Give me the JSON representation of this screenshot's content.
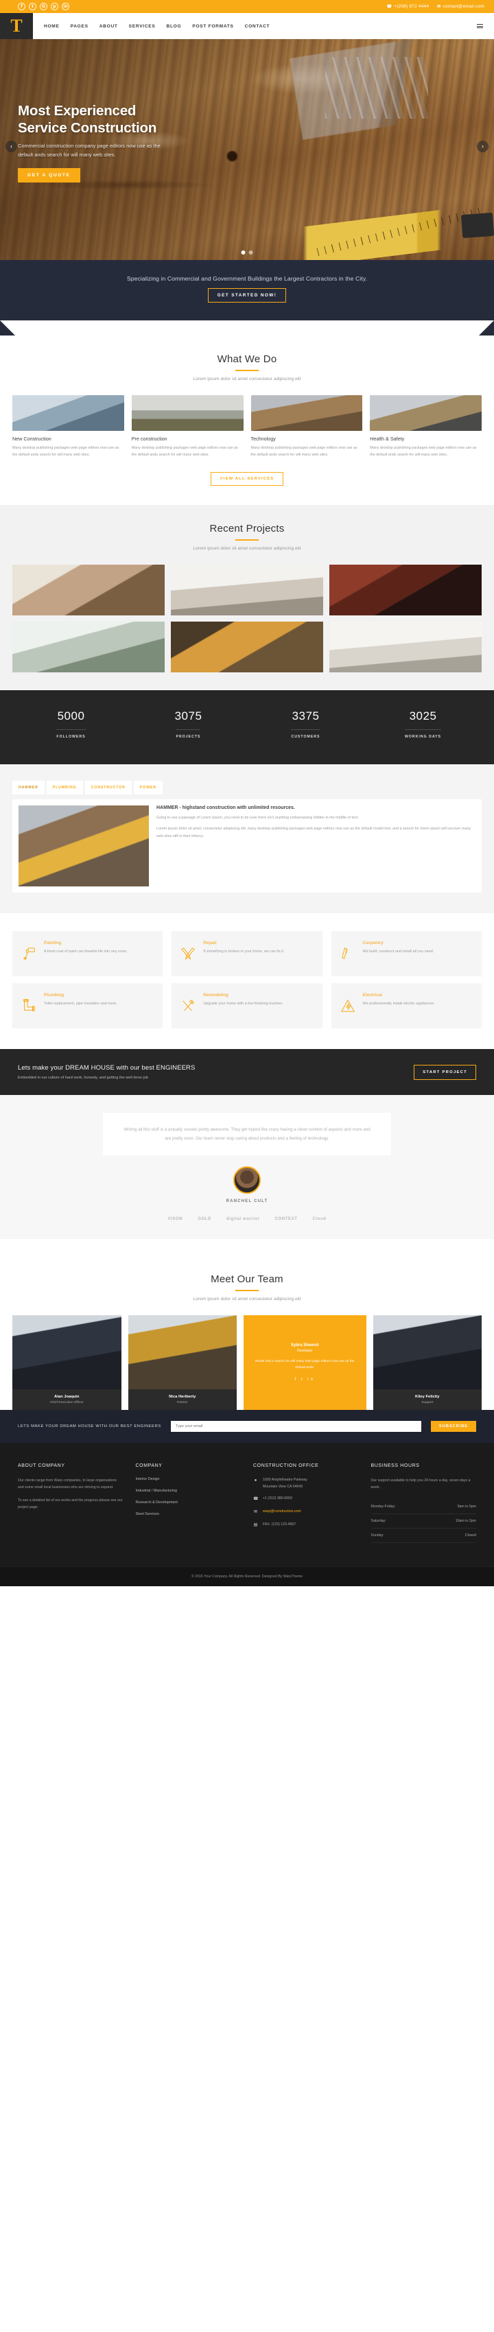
{
  "topbar": {
    "social": [
      {
        "name": "facebook-icon",
        "glyph": "f"
      },
      {
        "name": "twitter-icon",
        "glyph": "t"
      },
      {
        "name": "google-plus-icon",
        "glyph": "G"
      },
      {
        "name": "pinterest-icon",
        "glyph": "p"
      },
      {
        "name": "linkedin-icon",
        "glyph": "in"
      }
    ],
    "phone": "+(208) 872 4444",
    "email": "contact@email.com"
  },
  "nav": {
    "logo": "T",
    "items": [
      {
        "label": "HOME"
      },
      {
        "label": "PAGES"
      },
      {
        "label": "ABOUT"
      },
      {
        "label": "SERVICES"
      },
      {
        "label": "BLOG"
      },
      {
        "label": "POST FORMATS"
      },
      {
        "label": "CONTACT"
      }
    ]
  },
  "hero": {
    "title_line1": "Most Experienced",
    "title_line2": "Service Construction",
    "subtitle": "Commercial construction company page editors now use as the default ands search for will many web sites.",
    "cta": "GET A QUOTE",
    "prev": "‹",
    "next": "›"
  },
  "band": {
    "text": "Specializing in Commercial and Government Buildings the Largest Contractors in the City.",
    "cta": "GET STARTED NOW!"
  },
  "what_we_do": {
    "title": "What We Do",
    "subtitle": "Lorem ipsum dolor sit amet consectetur adipiscing elit",
    "cards": [
      {
        "title": "New Construction",
        "text": "Many desktop publishing packages web page editors now use as the default ands search for will many web sites."
      },
      {
        "title": "Pre construction",
        "text": "Many desktop publishing packages web page editors now use as the default ands search for will many web sites."
      },
      {
        "title": "Technology",
        "text": "Many desktop publishing packages web page editors now use as the default ands search for will many web sites."
      },
      {
        "title": "Health & Safety",
        "text": "Many desktop publishing packages web page editors now use as the default ands search for will many web sites."
      }
    ],
    "see_all": "VIEW ALL SERVICES"
  },
  "projects": {
    "title": "Recent Projects",
    "subtitle": "Lorem ipsum dolor sit amet consectetur adipiscing elit"
  },
  "counters": [
    {
      "number": "5000",
      "label": "FOLLOWERS"
    },
    {
      "number": "3075",
      "label": "PROJECTS"
    },
    {
      "number": "3375",
      "label": "CUSTOMERS"
    },
    {
      "number": "3025",
      "label": "WORKING DAYS"
    }
  ],
  "tabs": {
    "items": [
      {
        "label": "HAMMER"
      },
      {
        "label": "PLUMBING"
      },
      {
        "label": "CONSTRUCTOR"
      },
      {
        "label": "POWER"
      }
    ],
    "active": "HAMMER",
    "heading": "HAMMER - highstand construction with unlimited resources.",
    "para1": "Going to use a passage of Lorem Ipsum, you need to be sure there isn't anything embarrassing hidden in the middle of text.",
    "para2": "Lorem ipsum dolor sit amet, consectetur adipiscing elit, many desktop publishing packages web page editors now use as the default model text, and a search for lorem ipsum will uncover many web sites still in their infancy."
  },
  "features": [
    {
      "title": "Painting",
      "text": "A fresh coat of paint can breathe life into any room.",
      "icon": "paint-roller-icon"
    },
    {
      "title": "Repair",
      "text": "If something is broken in your home, we can fix it.",
      "icon": "pliers-icon"
    },
    {
      "title": "Carpentry",
      "text": "We build, construct and install all you need.",
      "icon": "saw-icon"
    },
    {
      "title": "Plumbing",
      "text": "Toilet replacement, pipe insulation and more.",
      "icon": "pipe-icon"
    },
    {
      "title": "Remodeling",
      "text": "Upgrade your home with a few finishing touches.",
      "icon": "ruler-pencil-icon"
    },
    {
      "title": "Electrical",
      "text": "We professionally install electric appliances.",
      "icon": "electric-hazard-icon"
    }
  ],
  "dream": {
    "title": "Lets make your DREAM HOUSE with our best ENGINEERS",
    "subtitle": "Embedded in our culture of hard work, honesty, and getting the well done job",
    "cta": "START PROJECT"
  },
  "testimonial": {
    "quote": "Writing all this stuff is a actually sounds pretty awesome. They get hyped like crazy having a clean context of aspects and more and are pretty soon. Our team never stop caring about products and a feeling of technology.",
    "name": "RANCHEL CULT"
  },
  "client_logos": [
    "VISON",
    "GOLD",
    "digital warrior",
    "CONTEXT",
    "Cloud"
  ],
  "team": {
    "title": "Meet Our Team",
    "subtitle": "Lorem ipsum dolor sit amet consectetur adipiscing elit",
    "members": [
      {
        "name": "Alan Joaquin",
        "role": "Chief Executive Officer",
        "highlight": false
      },
      {
        "name": "Nica Heriberty",
        "role": "Partner",
        "highlight": false
      },
      {
        "name": "Sybra Sheerot",
        "role": "Developer",
        "highlight": true,
        "bio": "Model and a search for will many web page editors now use as the default ands.",
        "social": "f  t  in"
      },
      {
        "name": "Kiley Felicity",
        "role": "Support",
        "highlight": false
      }
    ]
  },
  "subscribe": {
    "text": "LETS MAKE YOUR DREAM HOUSE WITH OUR BEST ENGINEERS",
    "placeholder": "Type your email",
    "button": "SUBSCRIBE"
  },
  "footer": {
    "about": {
      "title": "ABOUT COMPANY",
      "p1": "Our clients range from Warp companies, to large organisations and some small local businesses who are striving to expand.",
      "p2": "To see a detailed list of our works and the progress please see our project page."
    },
    "company": {
      "title": "COMPANY",
      "links": [
        "Interior Design",
        "Industrial / Manufacturing",
        "Research & Development",
        "Steel Services"
      ]
    },
    "office": {
      "title": "CONSTRUCTION OFFICE",
      "address_line1": "1600 Amphitheatre Parkway",
      "address_line2": "Mountain View CA 94043",
      "phone": "+1 (312) 380-6650",
      "email": "warp@construction.com",
      "fax": "FAX. (123) 123-4567"
    },
    "hours": {
      "title": "BUSINESS HOURS",
      "note": "Our support available to help you 24 hours a day, seven days a week.",
      "rows": [
        {
          "day": "Monday-Friday:",
          "time": "9am to 5pm"
        },
        {
          "day": "Saturday:",
          "time": "10am to 2pm"
        },
        {
          "day": "Sunday:",
          "time": "Closed"
        }
      ]
    },
    "copyright": "© 2016 Your Company. All Rights Reserved. Designed By WarpTheme"
  },
  "colors": {
    "accent": "#f9ab15",
    "dark": "#262626",
    "navy": "#262b3c"
  }
}
